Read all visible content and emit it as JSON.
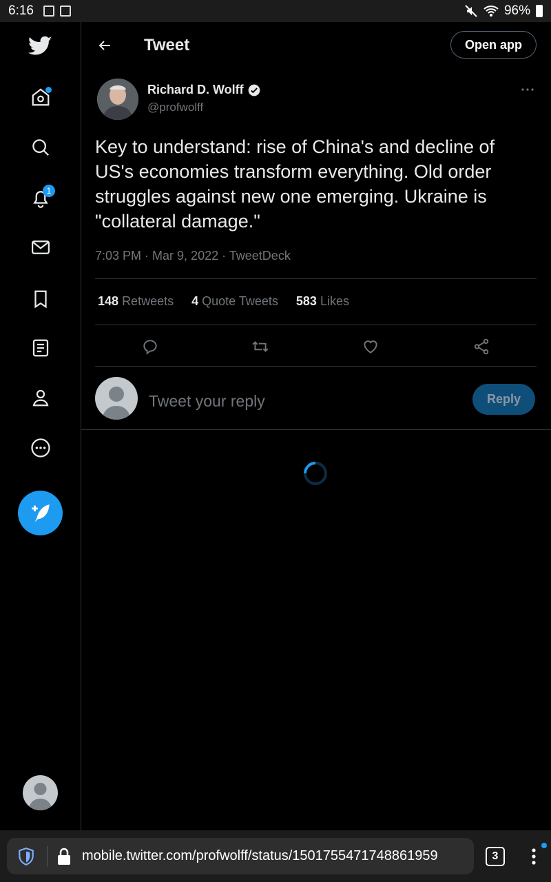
{
  "status_bar": {
    "time": "6:16",
    "battery": "96%"
  },
  "nav": {
    "notifications_badge": "1",
    "items": [
      "home",
      "explore",
      "notifications",
      "messages",
      "bookmarks",
      "lists",
      "profile",
      "more"
    ]
  },
  "header": {
    "title": "Tweet",
    "open_app": "Open app"
  },
  "tweet": {
    "author_name": "Richard D. Wolff",
    "author_handle": "@profwolff",
    "text": "Key to understand: rise of China's and decline of US's economies transform everything. Old order struggles against new one emerging. Ukraine is \"collateral damage.\"",
    "time": "7:03 PM",
    "date": "Mar 9, 2022",
    "source": "TweetDeck",
    "retweets_count": "148",
    "retweets_label": "Retweets",
    "quotes_count": "4",
    "quotes_label": "Quote Tweets",
    "likes_count": "583",
    "likes_label": "Likes"
  },
  "reply": {
    "placeholder": "Tweet your reply",
    "button": "Reply"
  },
  "browser": {
    "url": "mobile.twitter.com/profwolff/status/1501755471748861959",
    "tab_count": "3"
  },
  "colors": {
    "accent": "#1d9bf0",
    "background": "#000000",
    "muted": "#71767b"
  }
}
